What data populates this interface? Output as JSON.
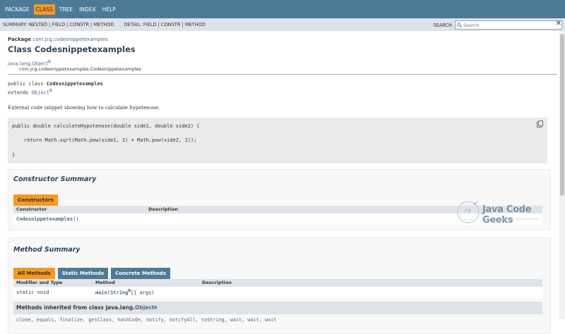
{
  "topnav": {
    "items": [
      "PACKAGE",
      "CLASS",
      "TREE",
      "INDEX",
      "HELP"
    ],
    "active_index": 1
  },
  "subnav": {
    "summary": "SUMMARY: NESTED | FIELD | CONSTR | METHOD",
    "detail": "DETAIL: FIELD | CONSTR | METHOD",
    "search_label": "SEARCH",
    "search_placeholder": "Search"
  },
  "header": {
    "package_label": "Package",
    "package_name": "com.jcg.codesnippetexamples",
    "class_title": "Class Codesnippetexamples",
    "superclass": "java.lang.Object",
    "class_fqn": "com.jcg.codesnippetexamples.Codesnippetexamples"
  },
  "signature": {
    "line1_prefix": "public class ",
    "line1_name": "Codesnippetexamples",
    "line2_prefix": "extends ",
    "line2_link": "Object"
  },
  "description": "External code snippet showing how to calculate hypotenuse.",
  "code": {
    "line1": "public double calculateHypotenuse(double side1, double side2) {",
    "line2": "return Math.sqrt(Math.pow(side1, 2) + Math.pow(side2, 2));",
    "line3": "}"
  },
  "constructor_summary": {
    "title": "Constructor Summary",
    "tab": "Constructors",
    "col1": "Constructor",
    "col2": "Description",
    "row_name": "Codesnippetexamples",
    "row_suffix": "()"
  },
  "method_summary": {
    "title": "Method Summary",
    "tabs": [
      "All Methods",
      "Static Methods",
      "Concrete Methods"
    ],
    "col1": "Modifier and Type",
    "col2": "Method",
    "col3": "Description",
    "row_modifier": "static void",
    "row_method": "main",
    "row_param_type": "String",
    "row_param_rest": "[] args)",
    "inherited_prefix": "Methods inherited from class java.lang.",
    "inherited_link": "Object",
    "inherited_methods": "clone, equals, finalize, getClass, hashCode, notify, notifyAll, toString, wait, wait, wait"
  },
  "logo": {
    "brand": "Java Code Geeks",
    "sub": "JAVA 2 JAVA DEVELOPERS RESOURCE CENTER",
    "badge": "jcg"
  },
  "colors": {
    "nav": "#4d7a97",
    "accent": "#f8981d",
    "subnav": "#dee3e9",
    "link": "#4a6782"
  }
}
